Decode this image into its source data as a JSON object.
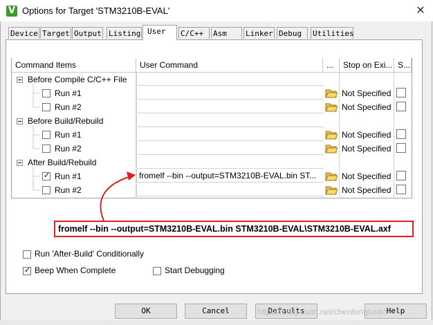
{
  "window": {
    "title": "Options for Target 'STM3210B-EVAL'",
    "close_glyph": "✕",
    "icon_letter": "V"
  },
  "tabs": [
    {
      "label": "Device",
      "active": false
    },
    {
      "label": "Target",
      "active": false
    },
    {
      "label": "Output",
      "active": false
    },
    {
      "label": "Listing",
      "active": false
    },
    {
      "label": "User",
      "active": true
    },
    {
      "label": "C/C++",
      "active": false
    },
    {
      "label": "Asm",
      "active": false
    },
    {
      "label": "Linker",
      "active": false
    },
    {
      "label": "Debug",
      "active": false
    },
    {
      "label": "Utilities",
      "active": false
    }
  ],
  "grid": {
    "headers": {
      "command_items": "Command Items",
      "user_command": "User Command",
      "dots": "...",
      "stop_on_exit": "Stop on Exi...",
      "s": "S..."
    },
    "groups": [
      {
        "label": "Before Compile C/C++ File",
        "runs": [
          {
            "label": "Run #1",
            "checked": false,
            "command": "",
            "stop": "Not Specified"
          },
          {
            "label": "Run #2",
            "checked": false,
            "command": "",
            "stop": "Not Specified"
          }
        ]
      },
      {
        "label": "Before Build/Rebuild",
        "runs": [
          {
            "label": "Run #1",
            "checked": false,
            "command": "",
            "stop": "Not Specified"
          },
          {
            "label": "Run #2",
            "checked": false,
            "command": "",
            "stop": "Not Specified"
          }
        ]
      },
      {
        "label": "After Build/Rebuild",
        "runs": [
          {
            "label": "Run #1",
            "checked": true,
            "command": "fromelf --bin --output=STM3210B-EVAL.bin ST...",
            "stop": "Not Specified"
          },
          {
            "label": "Run #2",
            "checked": false,
            "command": "",
            "stop": "Not Specified"
          }
        ]
      }
    ]
  },
  "annotation": {
    "text": "fromelf --bin --output=STM3210B-EVAL.bin STM3210B-EVAL\\STM3210B-EVAL.axf",
    "color": "#e02020"
  },
  "options": {
    "run_after_build": {
      "label": "Run 'After-Build' Conditionally",
      "checked": false
    },
    "beep_when_complete": {
      "label": "Beep When Complete",
      "checked": true
    },
    "start_debugging": {
      "label": "Start Debugging",
      "checked": false
    }
  },
  "buttons": {
    "ok": "OK",
    "cancel": "Cancel",
    "defaults": "Defaults",
    "help": "Help"
  },
  "watermark": "https://blog.csdn.net/chentengkeiko"
}
